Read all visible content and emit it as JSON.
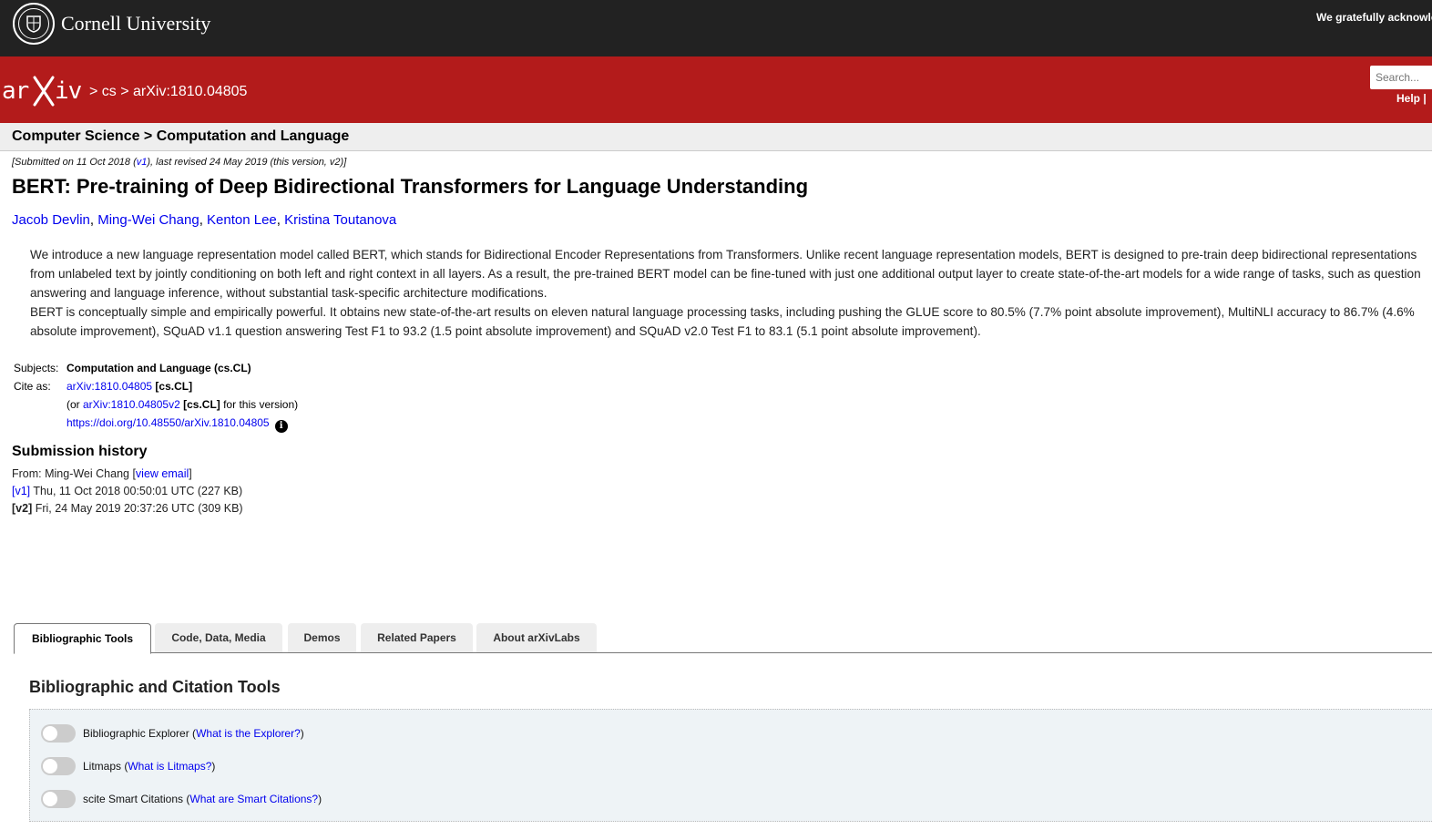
{
  "cornell": {
    "name": "Cornell University",
    "acknowledge": "We gratefully acknowle"
  },
  "header": {
    "logo_text": "arXiv",
    "breadcrumb": "> cs > arXiv:1810.04805",
    "search_placeholder": "Search...",
    "help": "Help |"
  },
  "subject_bar": {
    "heading": "Computer Science > Computation and Language"
  },
  "paper": {
    "dateline_pre": "[Submitted on 11 Oct 2018 (",
    "dateline_v1": "v1",
    "dateline_post": "), last revised 24 May 2019 (this version, v2)]",
    "title": "BERT: Pre-training of Deep Bidirectional Transformers for Language Understanding",
    "authors": [
      "Jacob Devlin",
      "Ming-Wei Chang",
      "Kenton Lee",
      "Kristina Toutanova"
    ],
    "abstract_p1": "We introduce a new language representation model called BERT, which stands for Bidirectional Encoder Representations from Transformers. Unlike recent language representation models, BERT is designed to pre-train deep bidirectional representations from unlabeled text by jointly conditioning on both left and right context in all layers. As a result, the pre-trained BERT model can be fine-tuned with just one additional output layer to create state-of-the-art models for a wide range of tasks, such as question answering and language inference, without substantial task-specific architecture modifications.",
    "abstract_p2": "BERT is conceptually simple and empirically powerful. It obtains new state-of-the-art results on eleven natural language processing tasks, including pushing the GLUE score to 80.5% (7.7% point absolute improvement), MultiNLI accuracy to 86.7% (4.6% absolute improvement), SQuAD v1.1 question answering Test F1 to 93.2 (1.5 point absolute improvement) and SQuAD v2.0 Test F1 to 83.1 (5.1 point absolute improvement)."
  },
  "meta": {
    "subjects_label": "Subjects:",
    "subjects_value": "Computation and Language (cs.CL)",
    "cite_label": "Cite as:",
    "cite_link": "arXiv:1810.04805",
    "cite_tag": "[cs.CL]",
    "cite2_pre": "(or ",
    "cite2_link": "arXiv:1810.04805v2",
    "cite2_tag": "[cs.CL]",
    "cite2_post": " for this version)",
    "doi": "https://doi.org/10.48550/arXiv.1810.04805",
    "info_icon": "i"
  },
  "history": {
    "title": "Submission history",
    "from_pre": "From: Ming-Wei Chang [",
    "from_link": "view email",
    "from_post": "]",
    "v1_label": "[v1]",
    "v1_text": " Thu, 11 Oct 2018 00:50:01 UTC (227 KB)",
    "v2_label": "[v2]",
    "v2_text": " Fri, 24 May 2019 20:37:26 UTC (309 KB)"
  },
  "tabs": [
    "Bibliographic Tools",
    "Code, Data, Media",
    "Demos",
    "Related Papers",
    "About arXivLabs"
  ],
  "tools": {
    "title": "Bibliographic and Citation Tools",
    "items": [
      {
        "label": "Bibliographic Explorer (",
        "link": "What is the Explorer?",
        "post": ")"
      },
      {
        "label": "Litmaps (",
        "link": "What is Litmaps?",
        "post": ")"
      },
      {
        "label": "scite Smart Citations (",
        "link": "What are Smart Citations?",
        "post": ")"
      }
    ]
  }
}
